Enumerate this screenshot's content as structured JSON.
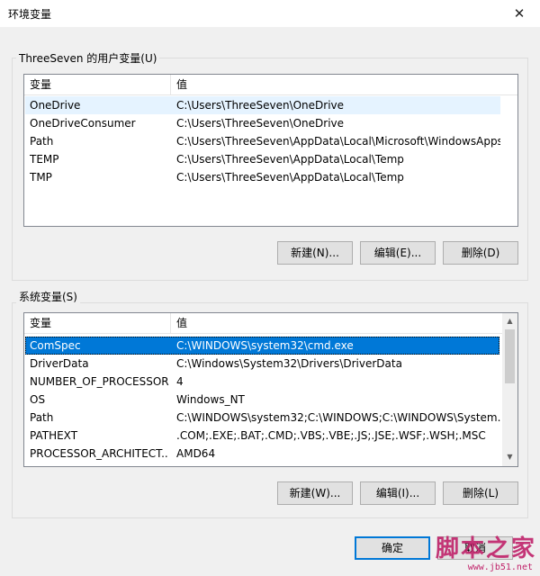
{
  "window": {
    "title": "环境变量",
    "close_glyph": "✕"
  },
  "user_vars": {
    "group_label": "ThreeSeven 的用户变量(U)",
    "columns": [
      "变量",
      "值"
    ],
    "rows": [
      {
        "name": "OneDrive",
        "value": "C:\\Users\\ThreeSeven\\OneDrive"
      },
      {
        "name": "OneDriveConsumer",
        "value": "C:\\Users\\ThreeSeven\\OneDrive"
      },
      {
        "name": "Path",
        "value": "C:\\Users\\ThreeSeven\\AppData\\Local\\Microsoft\\WindowsApps;"
      },
      {
        "name": "TEMP",
        "value": "C:\\Users\\ThreeSeven\\AppData\\Local\\Temp"
      },
      {
        "name": "TMP",
        "value": "C:\\Users\\ThreeSeven\\AppData\\Local\\Temp"
      }
    ],
    "buttons": {
      "new": "新建(N)...",
      "edit": "编辑(E)...",
      "delete": "删除(D)"
    }
  },
  "system_vars": {
    "group_label": "系统变量(S)",
    "columns": [
      "变量",
      "值"
    ],
    "rows": [
      {
        "name": "ComSpec",
        "value": "C:\\WINDOWS\\system32\\cmd.exe"
      },
      {
        "name": "DriverData",
        "value": "C:\\Windows\\System32\\Drivers\\DriverData"
      },
      {
        "name": "NUMBER_OF_PROCESSORS",
        "value": "4"
      },
      {
        "name": "OS",
        "value": "Windows_NT"
      },
      {
        "name": "Path",
        "value": "C:\\WINDOWS\\system32;C:\\WINDOWS;C:\\WINDOWS\\System..."
      },
      {
        "name": "PATHEXT",
        "value": ".COM;.EXE;.BAT;.CMD;.VBS;.VBE;.JS;.JSE;.WSF;.WSH;.MSC"
      },
      {
        "name": "PROCESSOR_ARCHITECT...",
        "value": "AMD64"
      }
    ],
    "buttons": {
      "new": "新建(W)...",
      "edit": "编辑(I)...",
      "delete": "删除(L)"
    }
  },
  "footer": {
    "ok": "确定",
    "cancel": "取消"
  },
  "watermark": {
    "text": "脚本之家",
    "url": "www.jb51.net"
  },
  "colors": {
    "selection": "#0078d7",
    "hover": "#e5f3ff",
    "watermark": "#c0226a"
  }
}
